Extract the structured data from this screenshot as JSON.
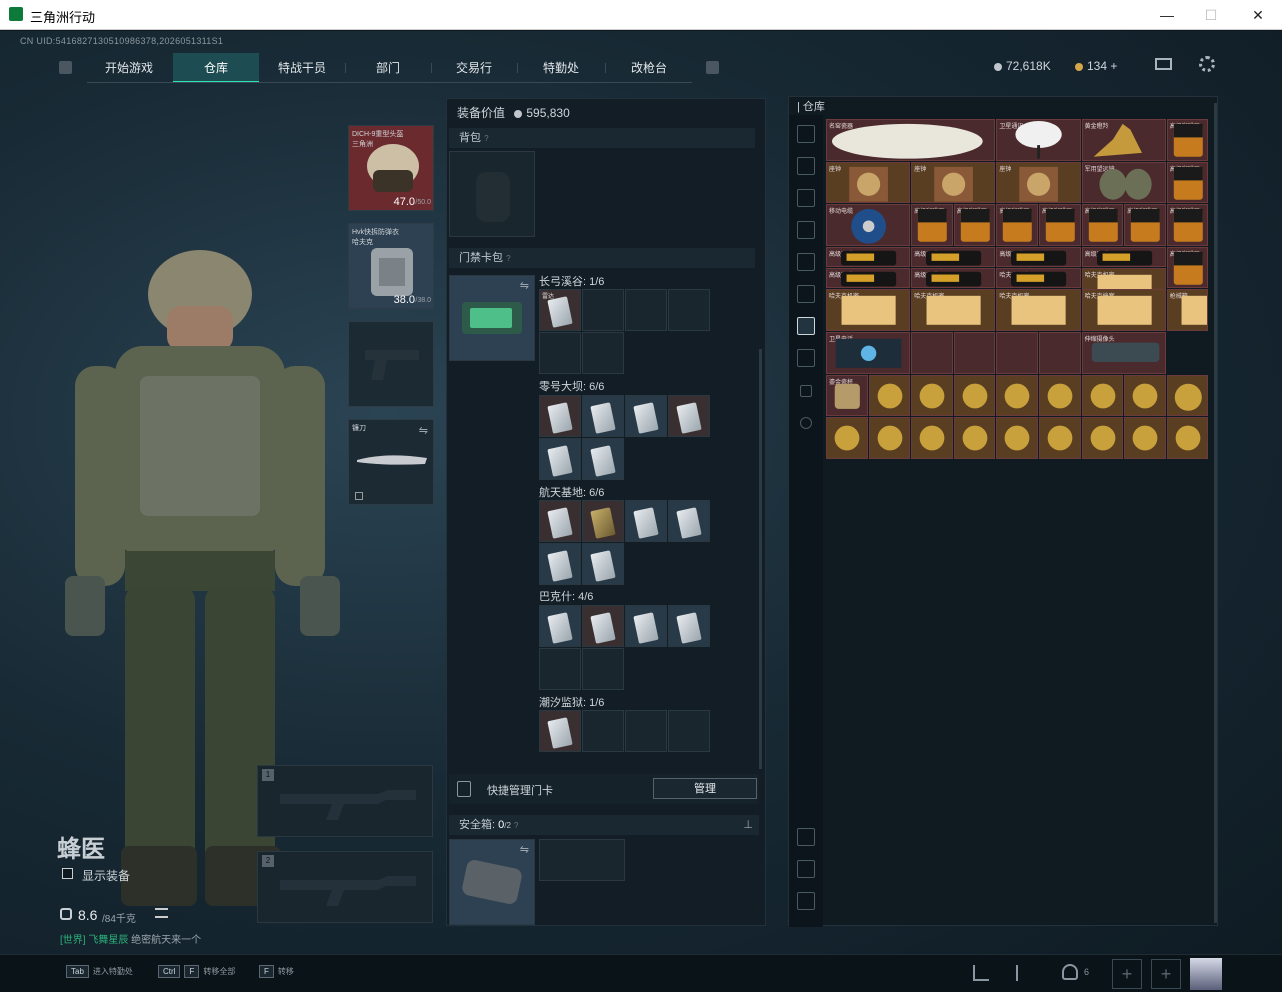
{
  "window": {
    "title": "三角洲行动",
    "minimize": "—",
    "maximize": "☐",
    "close": "✕"
  },
  "cnuid": "CN UID:5416827130510986378,2026051311S1",
  "nav": {
    "items": [
      "开始游戏",
      "仓库",
      "特战干员",
      "部门",
      "交易行",
      "特勤处",
      "改枪台"
    ],
    "active_index": 1
  },
  "currency": {
    "silver": "72,618K",
    "gold": "134"
  },
  "character": {
    "name": "蜂医",
    "show_equipment": "显示装备",
    "weight": "8.6",
    "weight_max": "/84千克",
    "chat_prefix": "[世界]",
    "chat_user": "飞舞星辰",
    "chat_text": "绝密航天来一个"
  },
  "gear": {
    "helmet_label": "DICH-9重型头盔",
    "helmet_sub": "三角洲",
    "helmet_value": "47.0",
    "helmet_max": "/50.0",
    "armor_label": "Hvk快拆防弹衣",
    "armor_sub": "哈夫克",
    "armor_value": "38.0",
    "armor_max": "/38.0",
    "melee_label": "镰刀",
    "weapon_slot_1": "1",
    "weapon_slot_2": "2"
  },
  "mid": {
    "equip_value_label": "装备价值",
    "equip_value": "595,830",
    "backpack_label": "背包",
    "keycard_label": "门禁卡包",
    "maps": [
      {
        "name": "长弓溪谷",
        "count": "1/6"
      },
      {
        "name": "零号大坝",
        "count": "6/6"
      },
      {
        "name": "航天基地",
        "count": "6/6"
      },
      {
        "name": "巴克什",
        "count": "4/6"
      },
      {
        "name": "潮汐监狱",
        "count": "1/6"
      }
    ],
    "quick_manage": "快捷管理门卡",
    "manage_button": "管理",
    "safebox_label": "安全箱:",
    "safebox_count": "0",
    "safebox_max": "/2"
  },
  "stash": {
    "title": "仓库",
    "items": [
      {
        "label": "名窑瓷器"
      },
      {
        "label": "卫星通讯"
      },
      {
        "label": "黄金瞪羚"
      },
      {
        "label": "高级咖啡豆"
      },
      {
        "label": "座钟"
      },
      {
        "label": "座钟"
      },
      {
        "label": "座钟"
      },
      {
        "label": "军用望远镜"
      },
      {
        "label": "高级咖啡豆"
      },
      {
        "label": "移动电缆"
      },
      {
        "label": "高级咖啡豆"
      },
      {
        "label": "高级咖啡豆"
      },
      {
        "label": "高级咖啡豆"
      },
      {
        "label": "高级咖啡豆"
      },
      {
        "label": "高级咖啡豆"
      },
      {
        "label": "高级咖啡豆"
      },
      {
        "label": "高级咖啡豆"
      },
      {
        "label": "高级咖啡豆"
      },
      {
        "label": "高级咖啡豆"
      },
      {
        "label": "高级咖啡豆"
      },
      {
        "label": "高级咖啡豆"
      },
      {
        "label": "高级咖啡豆"
      },
      {
        "label": "高级咖啡豆"
      },
      {
        "label": "高级咖啡豆"
      },
      {
        "label": "哈夫克机密"
      },
      {
        "label": "哈夫克机密"
      },
      {
        "label": "哈夫克机密"
      },
      {
        "label": "哈夫克机密"
      },
      {
        "label": "哈夫克机密"
      },
      {
        "label": "哈夫克档案"
      },
      {
        "label": "枪械箱"
      },
      {
        "label": "卫星电话"
      },
      {
        "label": "伸缩摄像头"
      },
      {
        "label": "鎏金瓷杯"
      }
    ]
  },
  "hotkeys": [
    {
      "key": "Tab",
      "label": "进入特勤处"
    },
    {
      "key": "Ctrl",
      "key2": "F",
      "label": "转移全部"
    },
    {
      "key": "F",
      "label": "转移"
    }
  ],
  "friends_count": "6"
}
